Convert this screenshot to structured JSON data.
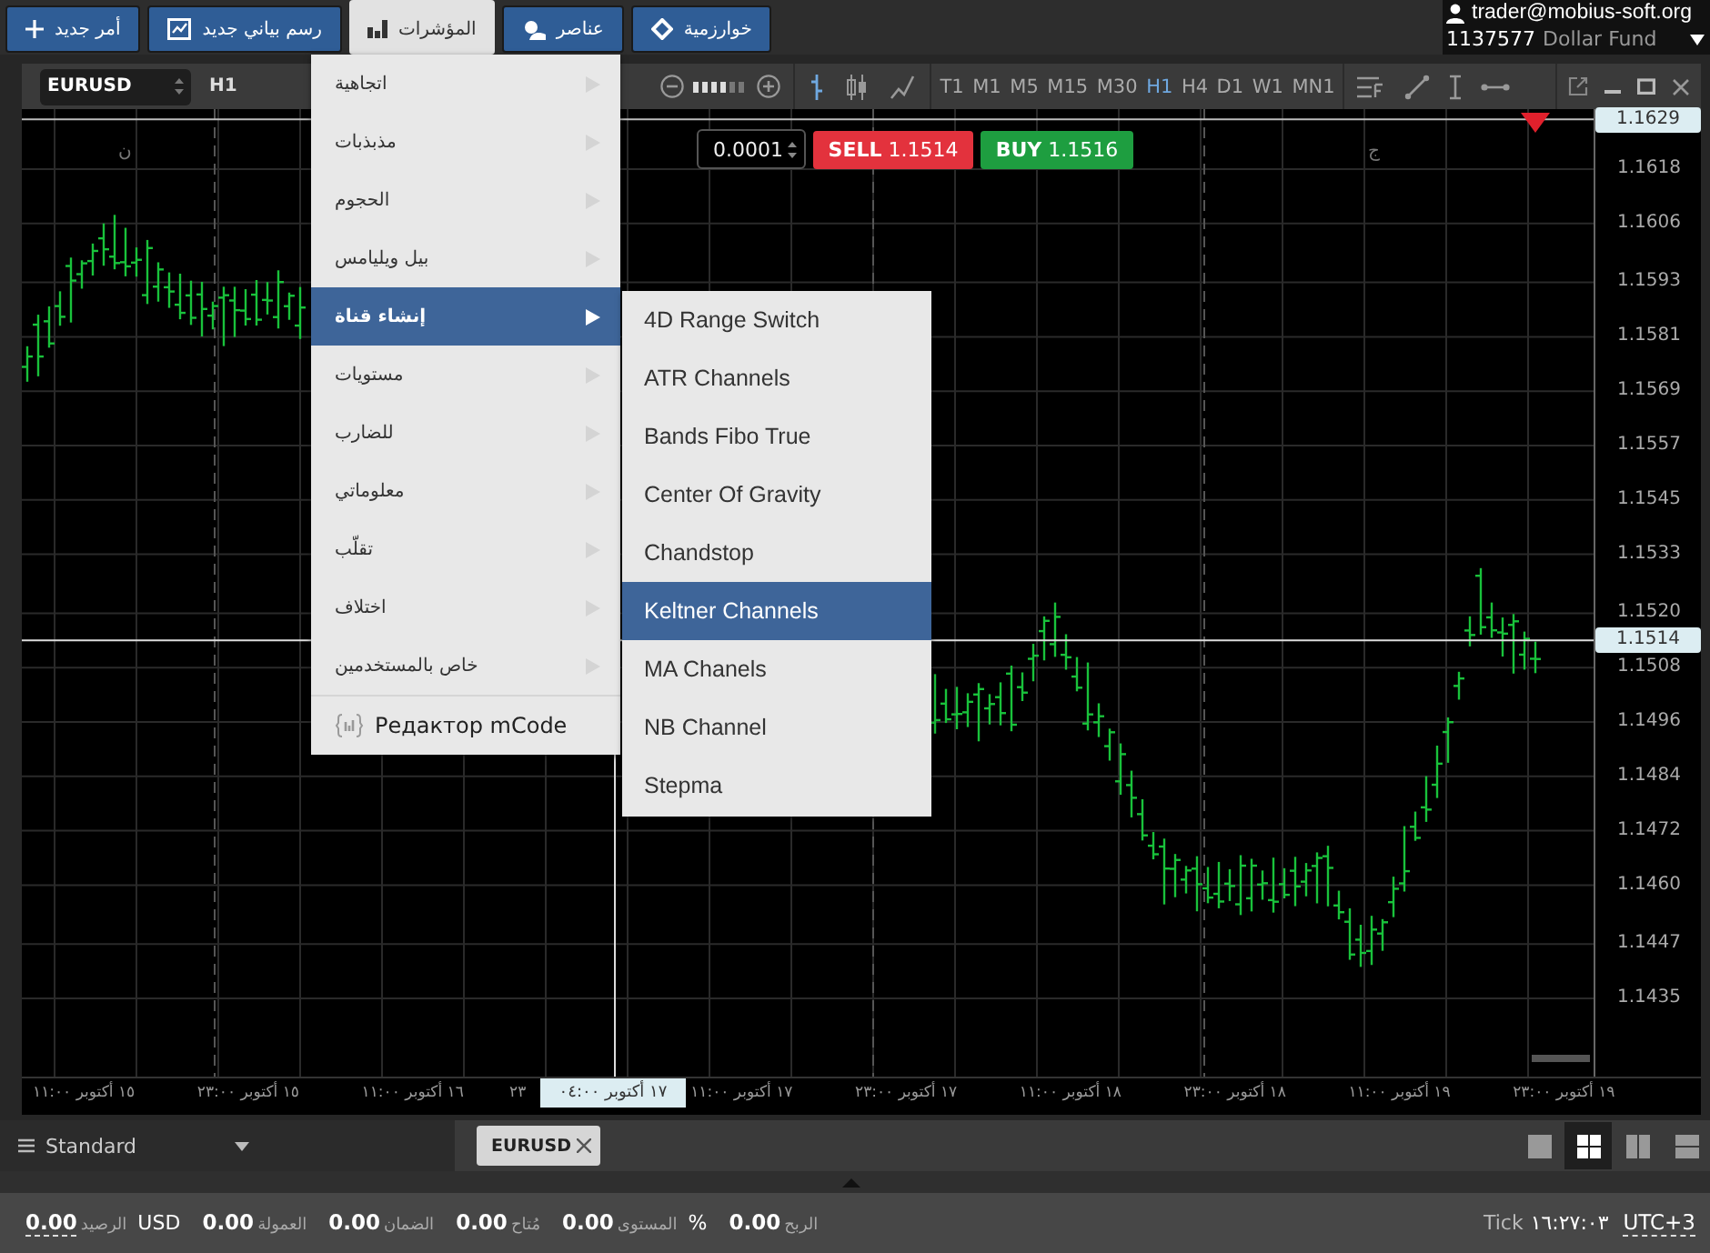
{
  "toolbar_buttons": [
    {
      "label": "خوارزمية",
      "kind": "diamond",
      "selected": false
    },
    {
      "label": "عناصر",
      "kind": "shapes",
      "selected": false
    },
    {
      "label": "المؤشرات",
      "kind": "bars",
      "selected": true
    },
    {
      "label": "رسم بياني جديد",
      "kind": "chart",
      "selected": false
    },
    {
      "label": "أمر جديد",
      "kind": "plus",
      "selected": false
    }
  ],
  "account": {
    "email": "trader@mobius-soft.org",
    "number": "1137577",
    "name": "Dollar Fund"
  },
  "chart_window": {
    "symbol": "EURUSD",
    "period": "H1",
    "zoom": {
      "level": 0.67
    },
    "chart_types": [
      {
        "kind": "line",
        "selected": false
      },
      {
        "kind": "candles",
        "selected": false
      },
      {
        "kind": "bars",
        "selected": true
      }
    ],
    "timeframes": [
      {
        "label": "MN1",
        "selected": false
      },
      {
        "label": "W1",
        "selected": false
      },
      {
        "label": "D1",
        "selected": false
      },
      {
        "label": "H4",
        "selected": false
      },
      {
        "label": "H1",
        "selected": true
      },
      {
        "label": "M30",
        "selected": false
      },
      {
        "label": "M15",
        "selected": false
      },
      {
        "label": "M5",
        "selected": false
      },
      {
        "label": "M1",
        "selected": false
      },
      {
        "label": "T1",
        "selected": false
      }
    ],
    "trade": {
      "quantity": "0.0001",
      "sell_label": "SELL",
      "sell_price": "1.1514",
      "buy_label": "BUY",
      "buy_price": "1.1516"
    },
    "chart_marks": [
      "ج",
      "ن"
    ],
    "price_axis": {
      "top_price": "1.1629",
      "current_price": "1.1514",
      "ticks": [
        "1.1618",
        "1.1606",
        "1.1593",
        "1.1581",
        "1.1569",
        "1.1557",
        "1.1545",
        "1.1533",
        "1.1520",
        "1.1508",
        "1.1496",
        "1.1484",
        "1.1472",
        "1.1460",
        "1.1447",
        "1.1435"
      ]
    },
    "time_axis": {
      "labels": [
        "١٩ أكتوبر ٢٣:٠٠",
        "١٩ أكتوبر ١١:٠٠",
        "١٨ أكتوبر ٢٣:٠٠",
        "١٨ أكتوبر ١١:٠٠",
        "١٧ أكتوبر ٢٣:٠٠",
        "١٧ أكتوبر ١١:٠٠",
        "٢٣",
        "١٦ أكتوبر ١١:٠٠",
        "١٥ أكتوبر ٢٣:٠٠",
        "١٥ أكتوبر ١١:٠٠"
      ],
      "cursor_label": "١٧ أكتوبر ٠٤:٠٠"
    }
  },
  "indicators_menu": {
    "items": [
      {
        "label": "اتجاهية",
        "selected": false
      },
      {
        "label": "مذبذبات",
        "selected": false
      },
      {
        "label": "الحجوم",
        "selected": false
      },
      {
        "label": "بيل ويليامس",
        "selected": false
      },
      {
        "label": "إنشاء قناة",
        "selected": true
      },
      {
        "label": "مستويات",
        "selected": false
      },
      {
        "label": "للضارب",
        "selected": false
      },
      {
        "label": "معلوماتي",
        "selected": false
      },
      {
        "label": "تقلّب",
        "selected": false
      },
      {
        "label": "اختلاف",
        "selected": false
      },
      {
        "label": "خاص بالمستخدمين",
        "selected": false
      }
    ],
    "editor": "Редактор mCode"
  },
  "submenu": {
    "items": [
      {
        "label": "4D Range Switch",
        "selected": false
      },
      {
        "label": "ATR Channels",
        "selected": false
      },
      {
        "label": "Bands Fibo True",
        "selected": false
      },
      {
        "label": "Center Of Gravity",
        "selected": false
      },
      {
        "label": "Chandstop",
        "selected": false
      },
      {
        "label": "Keltner Channels",
        "selected": true
      },
      {
        "label": "MA Chanels",
        "selected": false
      },
      {
        "label": "NB Channel",
        "selected": false
      },
      {
        "label": "Stepma",
        "selected": false
      }
    ]
  },
  "bottom_bar": {
    "workspace": "Standard",
    "tabs": [
      {
        "label": "EURUSD"
      }
    ],
    "layouts": [
      {
        "kind": "rows",
        "selected": false
      },
      {
        "kind": "columns",
        "selected": false
      },
      {
        "kind": "grid",
        "selected": true
      },
      {
        "kind": "single",
        "selected": false
      }
    ]
  },
  "status_bar": {
    "items": [
      {
        "value": "0.00",
        "label": "الربح"
      },
      {
        "value": "0.00",
        "label": "المستوى",
        "unit": "%"
      },
      {
        "value": "0.00",
        "label": "مُتاح"
      },
      {
        "value": "0.00",
        "label": "الضمان"
      },
      {
        "value": "0.00",
        "label": "العمولة"
      },
      {
        "value": "0.00",
        "label": "الرصيد",
        "unit": "USD"
      }
    ],
    "mode": "Tick",
    "time": "١٦:٢٧:٠٣",
    "timezone": "UTC+3"
  }
}
